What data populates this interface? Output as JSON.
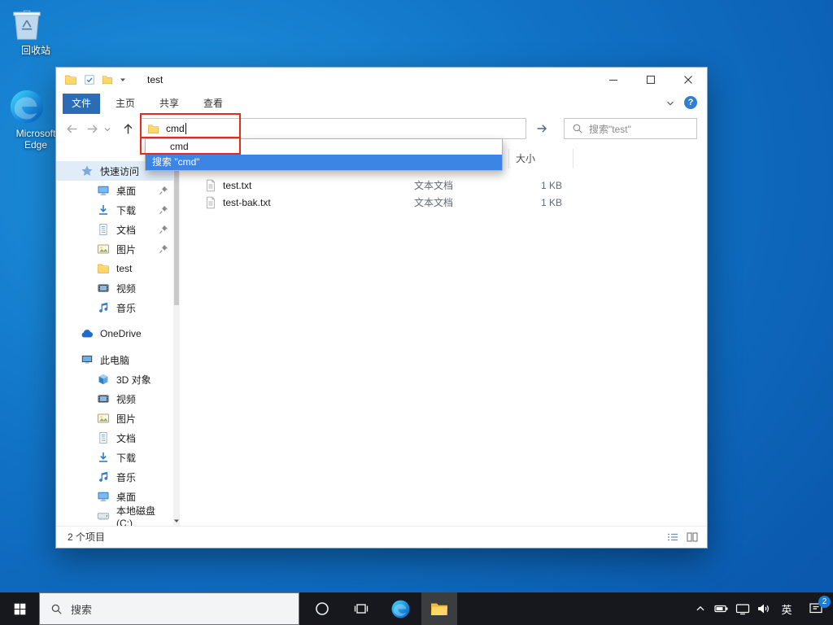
{
  "desktop": {
    "icons": [
      {
        "label": "回收站"
      },
      {
        "label": "Microsoft Edge"
      }
    ]
  },
  "explorer": {
    "title": "test",
    "ribbon": {
      "tabs": [
        "文件",
        "主页",
        "共享",
        "查看"
      ],
      "help": "?"
    },
    "navigation": {
      "address_value": "cmd",
      "dropdown": [
        {
          "label": "cmd"
        },
        {
          "label": "搜索 \"cmd\""
        }
      ],
      "search_placeholder": "搜索\"test\""
    },
    "columns": {
      "size_header": "大小"
    },
    "files": [
      {
        "name": "test.txt",
        "type": "文本文档",
        "size": "1 KB"
      },
      {
        "name": "test-bak.txt",
        "type": "文本文档",
        "size": "1 KB"
      }
    ],
    "sidebar": {
      "items": [
        {
          "label": "快速访问"
        },
        {
          "label": "桌面"
        },
        {
          "label": "下载"
        },
        {
          "label": "文档"
        },
        {
          "label": "图片"
        },
        {
          "label": "test"
        },
        {
          "label": "视频"
        },
        {
          "label": "音乐"
        },
        {
          "label": "OneDrive"
        },
        {
          "label": "此电脑"
        },
        {
          "label": "3D 对象"
        },
        {
          "label": "视频"
        },
        {
          "label": "图片"
        },
        {
          "label": "文档"
        },
        {
          "label": "下载"
        },
        {
          "label": "音乐"
        },
        {
          "label": "桌面"
        },
        {
          "label": "本地磁盘 (C:)"
        }
      ]
    },
    "status": {
      "item_count": "2 个项目"
    }
  },
  "taskbar": {
    "search_placeholder": "搜索",
    "language": "英",
    "badge": "2"
  },
  "colors": {
    "accent": "#0078d7",
    "selection": "#3d85e4",
    "annotation": "#e62a1c"
  }
}
